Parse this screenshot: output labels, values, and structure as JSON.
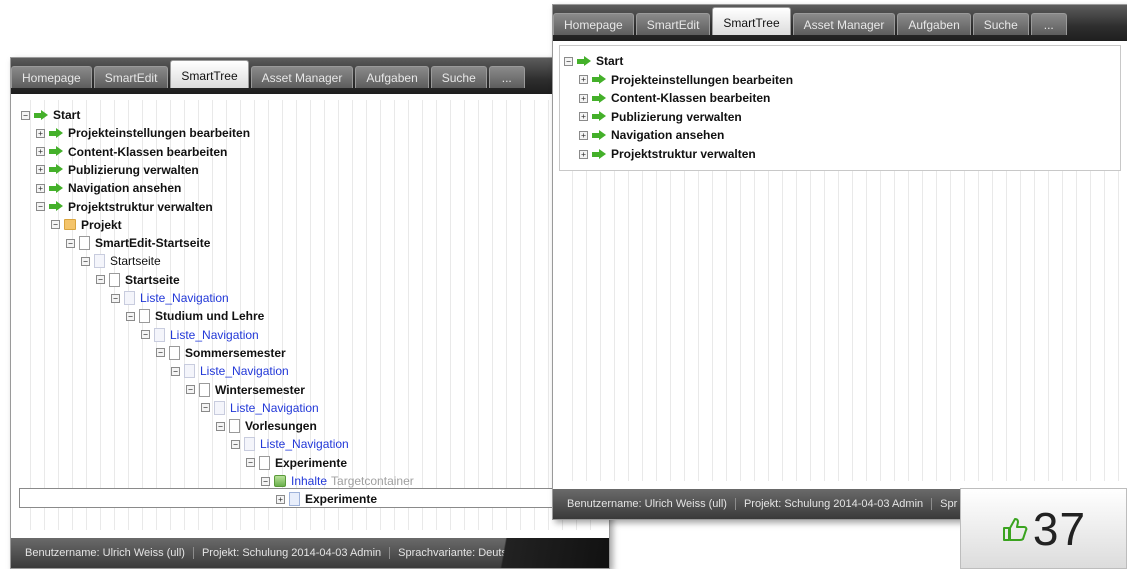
{
  "tabs": [
    {
      "label": "Homepage"
    },
    {
      "label": "SmartEdit"
    },
    {
      "label": "SmartTree"
    },
    {
      "label": "Asset Manager"
    },
    {
      "label": "Aufgaben"
    },
    {
      "label": "Suche"
    },
    {
      "label": "..."
    }
  ],
  "active_tab": "SmartTree",
  "tree_back": [
    {
      "label": "Start",
      "level": 0,
      "icon": "arrow-icon",
      "toggle": "−",
      "style": "bold"
    },
    {
      "label": "Projekteinstellungen bearbeiten",
      "level": 1,
      "icon": "arrow-icon",
      "toggle": "+",
      "style": "bold"
    },
    {
      "label": "Content-Klassen bearbeiten",
      "level": 1,
      "icon": "arrow-icon",
      "toggle": "+",
      "style": "bold"
    },
    {
      "label": "Publizierung verwalten",
      "level": 1,
      "icon": "arrow-icon",
      "toggle": "+",
      "style": "bold"
    },
    {
      "label": "Navigation ansehen",
      "level": 1,
      "icon": "arrow-icon",
      "toggle": "+",
      "style": "bold"
    },
    {
      "label": "Projektstruktur verwalten",
      "level": 1,
      "icon": "arrow-icon",
      "toggle": "−",
      "style": "bold"
    },
    {
      "label": "Projekt",
      "level": 2,
      "icon": "folder-icon",
      "toggle": "−",
      "style": "bold"
    },
    {
      "label": "SmartEdit-Startseite",
      "level": 3,
      "icon": "page-icon",
      "toggle": "−",
      "style": "bold"
    },
    {
      "label": "Startseite",
      "level": 4,
      "icon": "faded-page-icon",
      "toggle": "−",
      "style": "plain"
    },
    {
      "label": "Startseite",
      "level": 5,
      "icon": "page-icon",
      "toggle": "−",
      "style": "bold"
    },
    {
      "label": "Liste_Navigation",
      "level": 6,
      "icon": "faded-page-icon",
      "toggle": "−",
      "style": "link"
    },
    {
      "label": "Studium und Lehre",
      "level": 7,
      "icon": "page-icon",
      "toggle": "−",
      "style": "bold"
    },
    {
      "label": "Liste_Navigation",
      "level": 8,
      "icon": "faded-page-icon",
      "toggle": "−",
      "style": "link"
    },
    {
      "label": "Sommersemester",
      "level": 9,
      "icon": "page-icon",
      "toggle": "−",
      "style": "bold"
    },
    {
      "label": "Liste_Navigation",
      "level": 10,
      "icon": "faded-page-icon",
      "toggle": "−",
      "style": "link"
    },
    {
      "label": "Wintersemester",
      "level": 11,
      "icon": "page-icon",
      "toggle": "−",
      "style": "bold"
    },
    {
      "label": "Liste_Navigation",
      "level": 12,
      "icon": "faded-page-icon",
      "toggle": "−",
      "style": "link"
    },
    {
      "label": "Vorlesungen",
      "level": 13,
      "icon": "page-icon",
      "toggle": "−",
      "style": "bold"
    },
    {
      "label": "Liste_Navigation",
      "level": 14,
      "icon": "faded-page-icon",
      "toggle": "−",
      "style": "link"
    },
    {
      "label": "Experimente",
      "level": 15,
      "icon": "page-icon",
      "toggle": "−",
      "style": "bold"
    },
    {
      "label": "Inhalte",
      "suffix": "Targetcontainer",
      "level": 16,
      "icon": "container-icon",
      "toggle": "−",
      "style": "link"
    },
    {
      "label": "Experimente",
      "level": 17,
      "icon": "blue-page-icon",
      "toggle": "+",
      "style": "bold",
      "selected": true
    }
  ],
  "tree_front": [
    {
      "label": "Start",
      "level": 0,
      "toggle": "−"
    },
    {
      "label": "Projekteinstellungen bearbeiten",
      "level": 1,
      "toggle": "+"
    },
    {
      "label": "Content-Klassen bearbeiten",
      "level": 1,
      "toggle": "+"
    },
    {
      "label": "Publizierung verwalten",
      "level": 1,
      "toggle": "+"
    },
    {
      "label": "Navigation ansehen",
      "level": 1,
      "toggle": "+"
    },
    {
      "label": "Projektstruktur verwalten",
      "level": 1,
      "toggle": "+"
    }
  ],
  "status_back": {
    "user": "Benutzername: Ulrich Weiss (ull)",
    "project": "Projekt: Schulung 2014-04-03 Admin",
    "language": "Sprachvariante: Deutsch"
  },
  "status_front": {
    "user": "Benutzername: Ulrich Weiss (ull)",
    "project": "Projekt: Schulung 2014-04-03 Admin",
    "language_partial": "Spr"
  },
  "badge": {
    "count": "37",
    "icon": "thumbs-up-icon"
  }
}
